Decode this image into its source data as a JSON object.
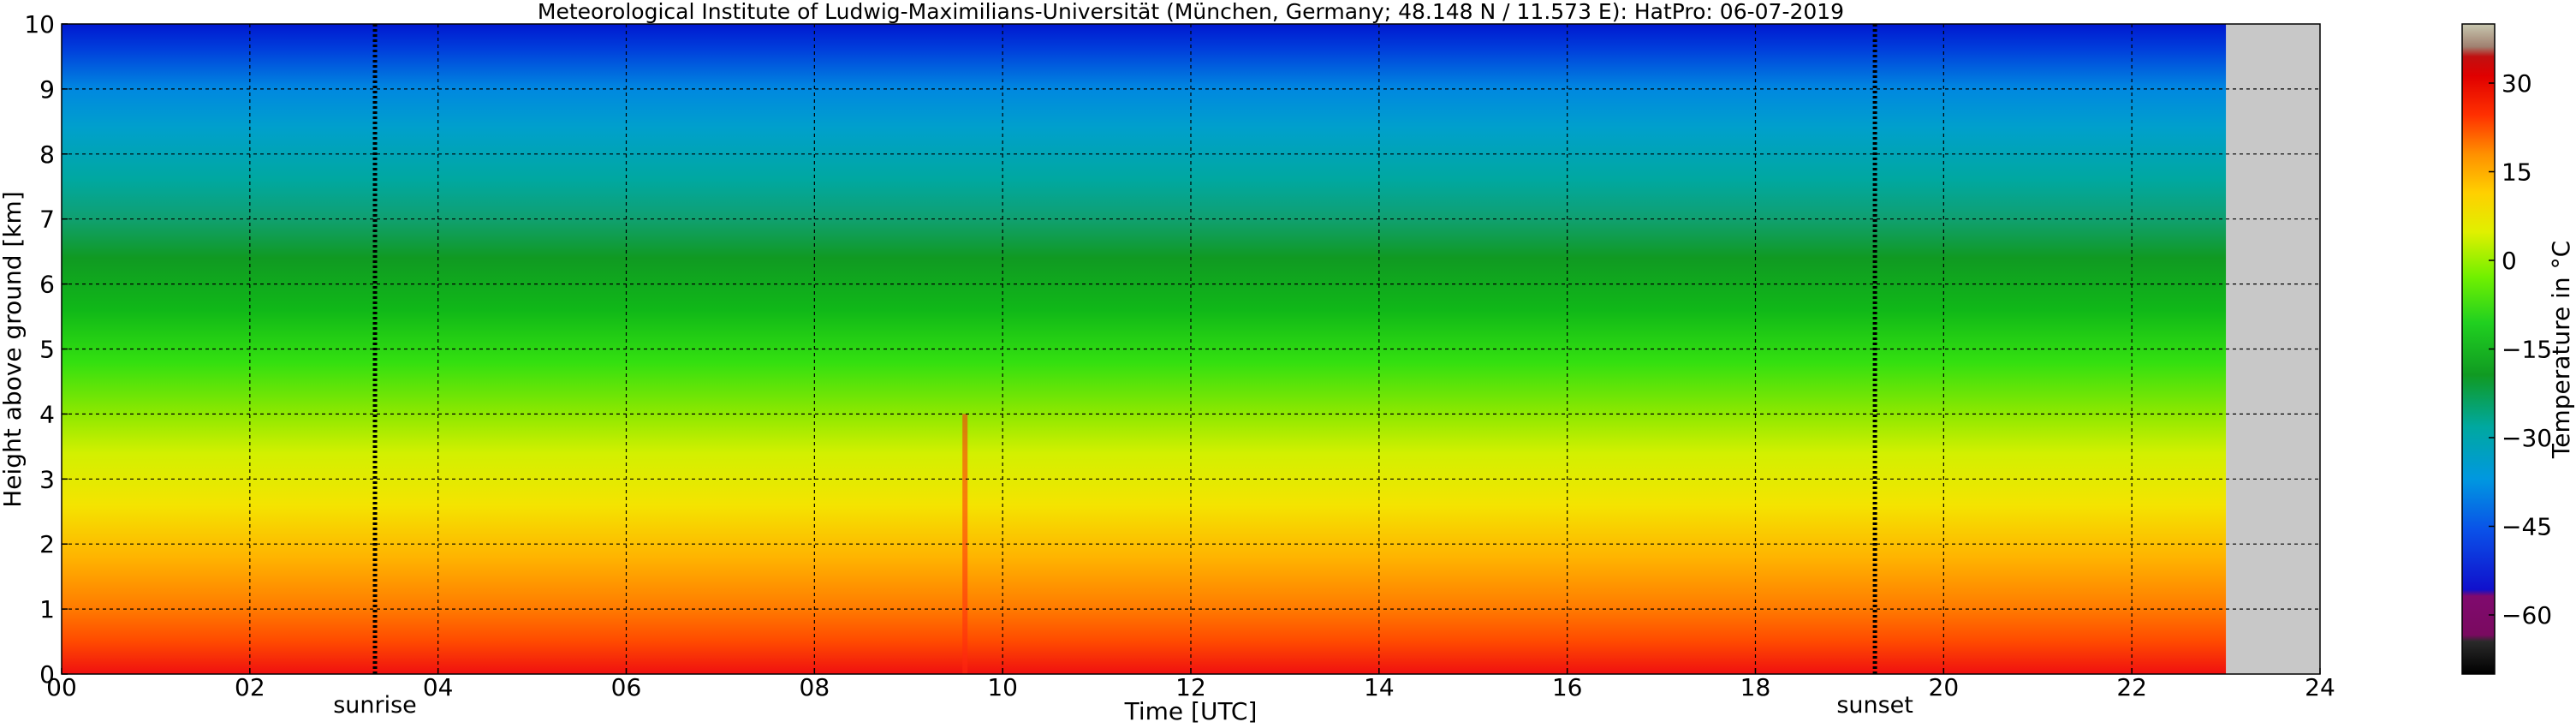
{
  "chart_data": {
    "type": "heatmap",
    "title": "Meteorological Institute of Ludwig-Maximilians-Universität (München, Germany; 48.148 N / 11.573 E):    HatPro: 06-07-2019",
    "xlabel": "Time [UTC]",
    "ylabel": "Height above ground [km]",
    "xlim": [
      0,
      24
    ],
    "ylim": [
      0,
      10
    ],
    "x_ticks": [
      "00",
      "02",
      "04",
      "06",
      "08",
      "10",
      "12",
      "14",
      "16",
      "18",
      "20",
      "22",
      "24"
    ],
    "y_ticks": [
      "0",
      "1",
      "2",
      "3",
      "4",
      "5",
      "6",
      "7",
      "8",
      "9",
      "10"
    ],
    "grid": true,
    "data_end_hour": 23.0,
    "no_data_color": "#c8c8c8",
    "annotations": [
      {
        "label": "sunrise",
        "x": 3.33
      },
      {
        "label": "sunset",
        "x": 19.27
      }
    ],
    "profile": {
      "height_km": [
        0,
        0.5,
        1,
        2,
        3,
        4,
        5,
        6,
        7,
        8,
        9,
        10
      ],
      "temperature_c": [
        31,
        26,
        22,
        12,
        4,
        -5,
        -12,
        -18,
        -26,
        -34,
        -44,
        -55
      ]
    },
    "colorbar": {
      "label": "Temperature in °C",
      "range": [
        -70,
        40
      ],
      "ticks": [
        "30",
        "15",
        "0",
        "−15",
        "−30",
        "−45",
        "−60"
      ],
      "tick_values": [
        30,
        15,
        0,
        -15,
        -30,
        -45,
        -60
      ]
    }
  }
}
